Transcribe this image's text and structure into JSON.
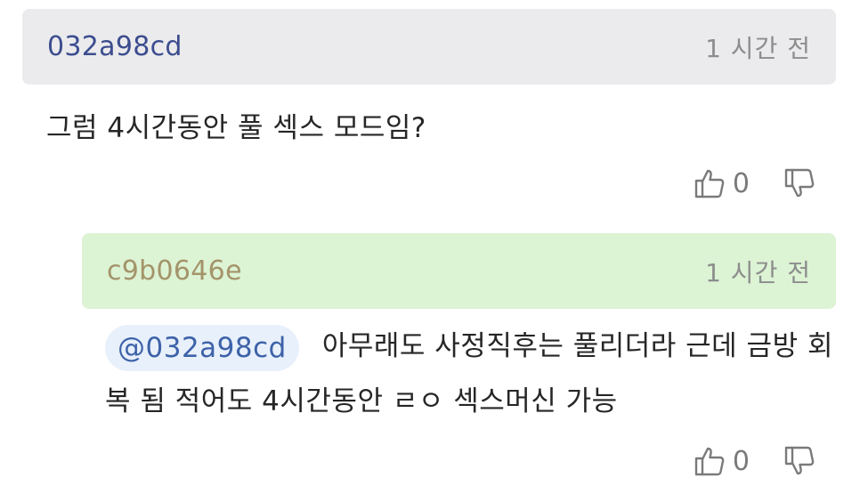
{
  "comments": [
    {
      "author": "032a98cd",
      "time": "1 시간 전",
      "text": "그럼 4시간동안 풀 섹스 모드임?",
      "likes": "0"
    },
    {
      "author": "c9b0646e",
      "time": "1 시간 전",
      "mention": "@032a98cd",
      "text": "아무래도 사정직후는 풀리더라 근데 금방 회복 됨 적어도 4시간동안 ㄹㅇ 섹스머신 가능",
      "likes": "0"
    }
  ],
  "icons": {
    "like": "thumbs-up-icon",
    "dislike": "thumbs-down-icon"
  },
  "colors": {
    "header_bg": "#ebebed",
    "reply_header_bg": "#dcf3d4",
    "author": "#3c4d8f",
    "reply_author": "#a4946a",
    "mention_bg": "#e8f0fb",
    "mention_text": "#3d62a8"
  }
}
